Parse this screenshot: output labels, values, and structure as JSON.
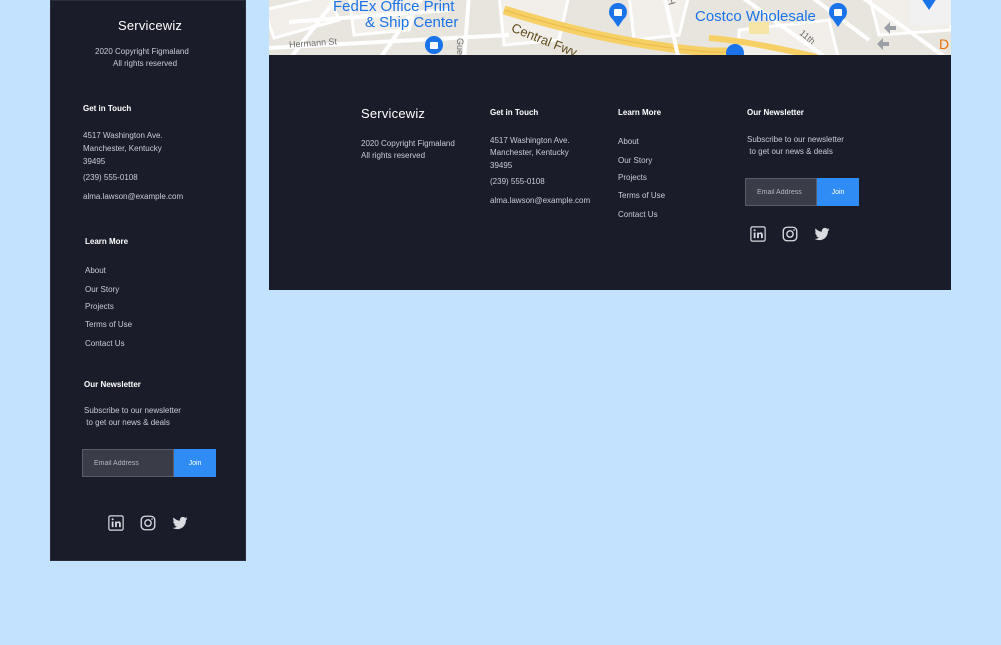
{
  "brand": "Servicewiz",
  "copyright": [
    "2020 Copyright Figmaland",
    "All rights reserved"
  ],
  "contact": {
    "heading": "Get in Touch",
    "address": [
      "4517 Washington Ave.",
      "Manchester, Kentucky",
      "39495"
    ],
    "phone": "(239) 555-0108",
    "email": "alma.lawson@example.com"
  },
  "learn_more": {
    "heading": "Learn More",
    "links": [
      "About",
      "Our Story",
      "Projects",
      "Terms of Use",
      "Contact Us"
    ]
  },
  "newsletter": {
    "heading": "Our Newsletter",
    "text": [
      "Subscribe to our newsletter",
      " to get our news & deals"
    ],
    "placeholder": "Email Address",
    "button": "Join"
  },
  "socials": [
    "linkedin-icon",
    "instagram-icon",
    "twitter-icon"
  ],
  "map": {
    "labels": {
      "fedex_1": "FedEx Office Print",
      "fedex_2": "& Ship Center",
      "costco": "Costco Wholesale",
      "central": "Central Fwy",
      "hermann": "Hermann St",
      "guerrero": "Gue",
      "eleventh": "11th",
      "h": "H",
      "d": "D"
    }
  },
  "colors": {
    "background": "#c2e2fd",
    "footer": "#1a1d29",
    "accent": "#2f8cf4"
  }
}
